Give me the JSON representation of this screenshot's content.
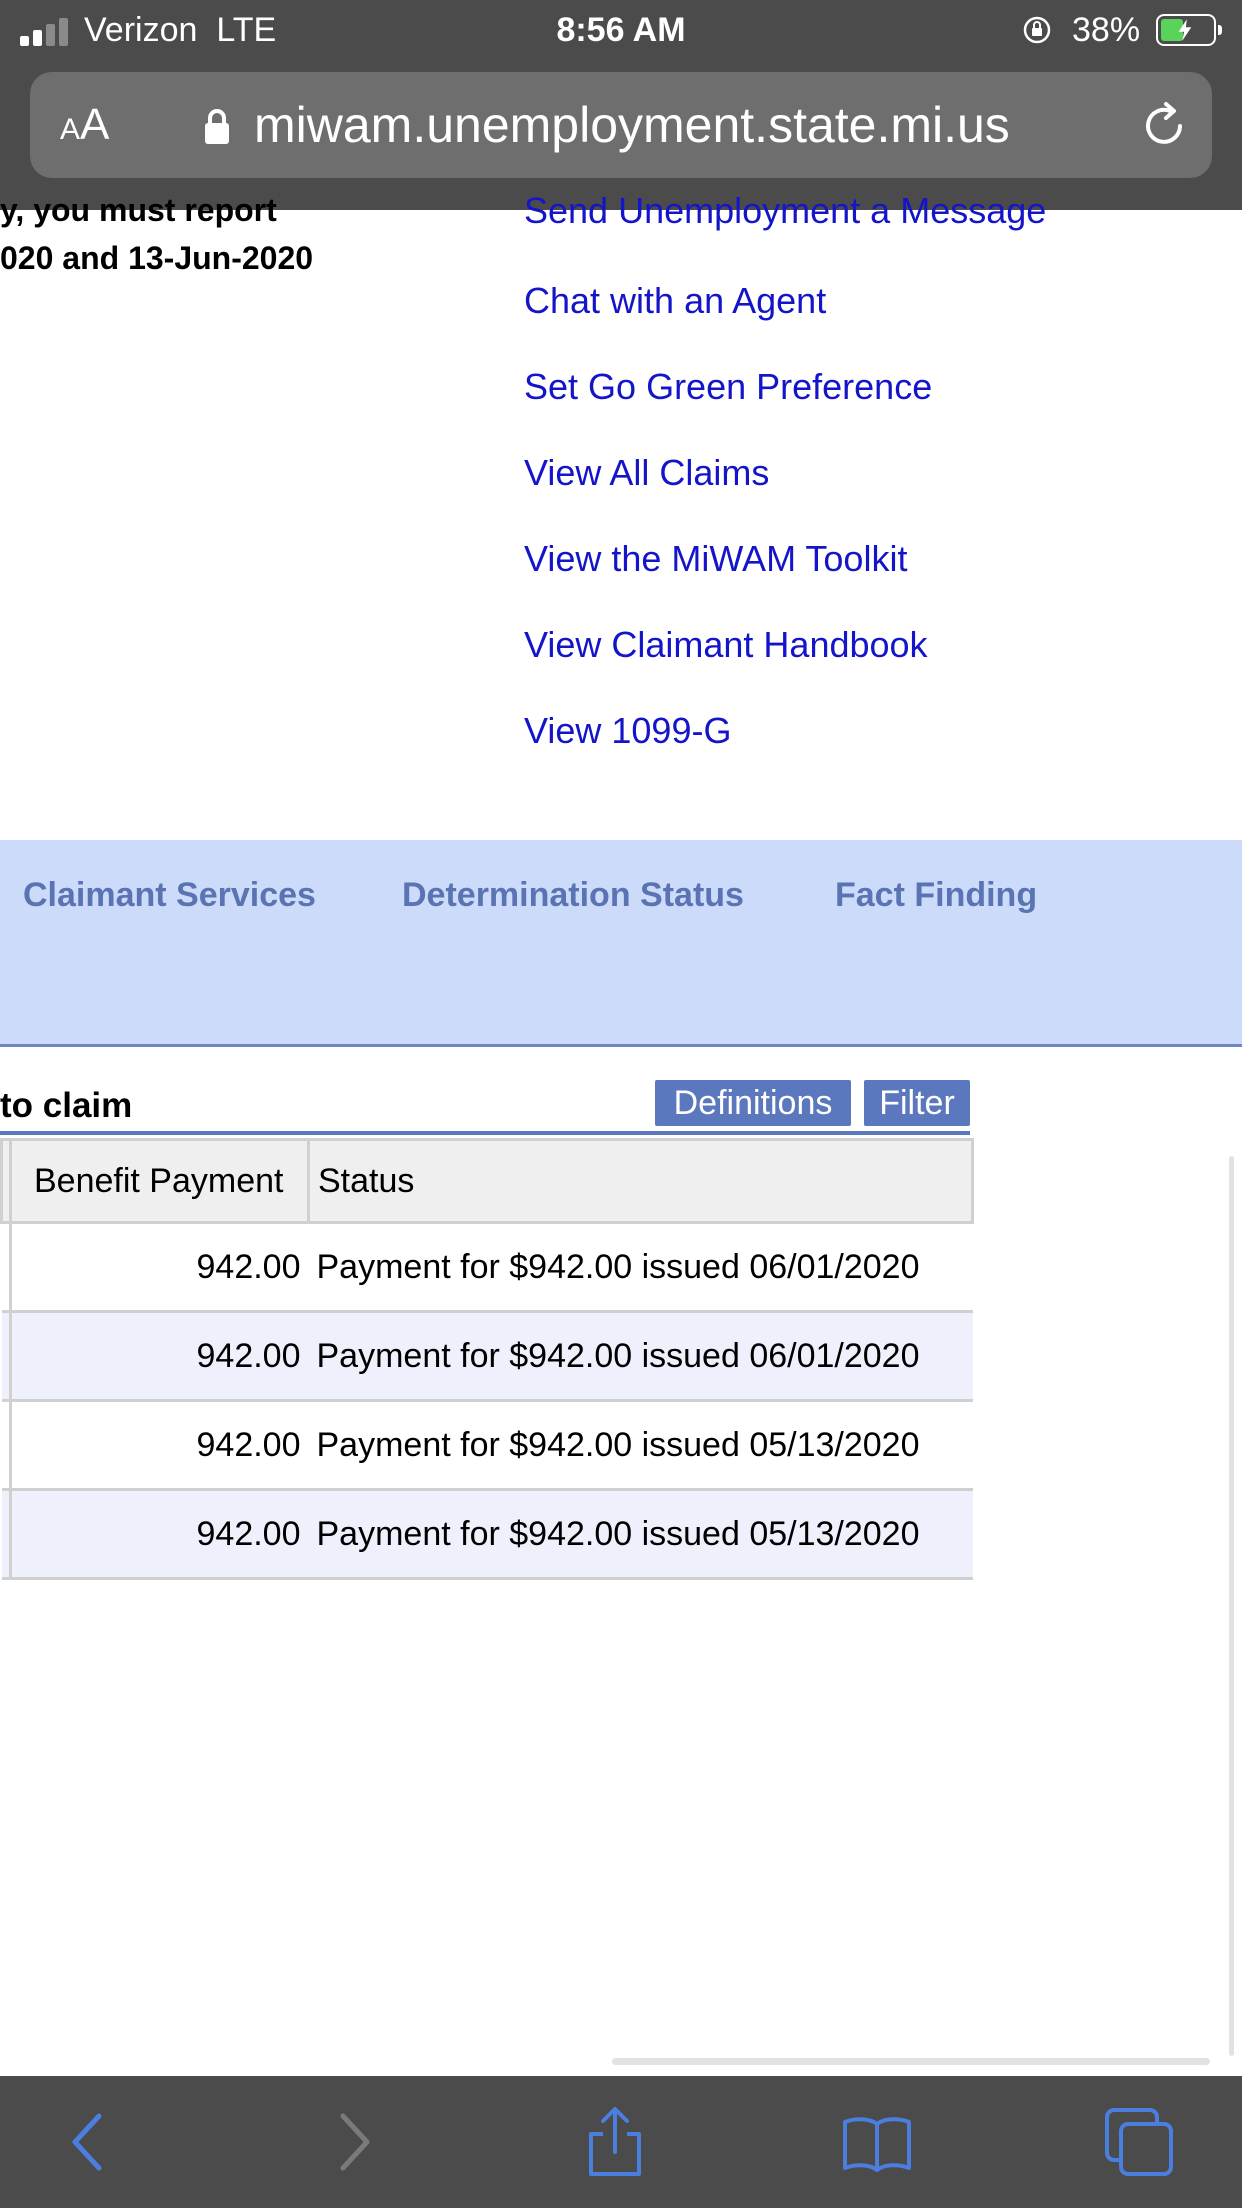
{
  "status_bar": {
    "carrier": "Verizon",
    "network": "LTE",
    "time": "8:56 AM",
    "battery_percent": "38%"
  },
  "browser": {
    "text_size_control": "AA",
    "url": "miwam.unemployment.state.mi.us"
  },
  "page": {
    "notice_line_1": "y, you must report",
    "notice_line_2": "020 and 13-Jun-2020",
    "partial_link": "Send Unemployment a Message",
    "links": [
      "Chat with an Agent",
      "Set Go Green Preference",
      "View All Claims",
      "View the MiWAM Toolkit",
      "View Claimant Handbook",
      "View 1099-G"
    ],
    "nav_tabs": [
      "Claimant Services",
      "Determination Status",
      "Fact Finding"
    ],
    "section_title": "to claim",
    "buttons": {
      "definitions": "Definitions",
      "filter": "Filter"
    },
    "table": {
      "headers": [
        "Benefit Payment",
        "Status"
      ],
      "rows": [
        {
          "amount": "942.00",
          "status": "Payment for $942.00 issued 06/01/2020"
        },
        {
          "amount": "942.00",
          "status": "Payment for $942.00 issued 06/01/2020"
        },
        {
          "amount": "942.00",
          "status": "Payment for $942.00 issued 05/13/2020"
        },
        {
          "amount": "942.00",
          "status": "Payment for $942.00 issued 05/13/2020"
        }
      ]
    }
  },
  "colors": {
    "link": "#1414c8",
    "nav_band": "#ccdbfa",
    "nav_text": "#5a73b3",
    "button": "#5b78be",
    "toolbar_icon": "#4a7fe0"
  },
  "toolbar_icons": [
    "back-icon",
    "forward-icon",
    "share-icon",
    "bookmarks-icon",
    "tabs-icon"
  ]
}
